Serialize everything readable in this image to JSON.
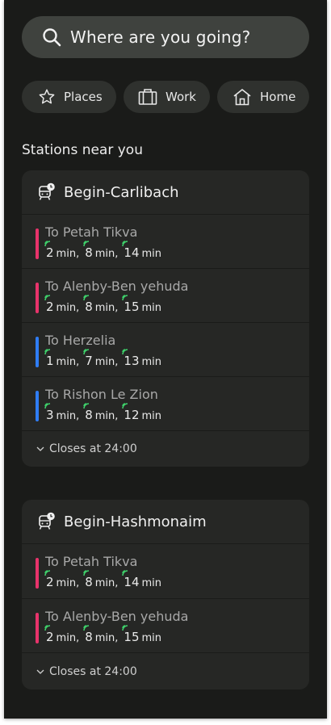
{
  "search": {
    "placeholder": "Where are you going?"
  },
  "quick_links": [
    {
      "label": "Places",
      "icon": "star-icon"
    },
    {
      "label": "Work",
      "icon": "briefcase-icon"
    },
    {
      "label": "Home",
      "icon": "home-icon"
    }
  ],
  "section_title": "Stations near you",
  "colors": {
    "pink": "#e8336b",
    "blue": "#2f7df5",
    "signal": "#3ecf6a"
  },
  "stations": [
    {
      "name": "Begin-Carlibach",
      "icon": "train-clock-icon",
      "routes": [
        {
          "dest": "To Petah Tikva",
          "color": "#e8336b",
          "times": [
            "2",
            "8",
            "14"
          ],
          "unit": "min"
        },
        {
          "dest": "To Alenby-Ben yehuda",
          "color": "#e8336b",
          "times": [
            "2",
            "8",
            "15"
          ],
          "unit": "min"
        },
        {
          "dest": "To Herzelia",
          "color": "#2f7df5",
          "times": [
            "1",
            "7",
            "13"
          ],
          "unit": "min"
        },
        {
          "dest": "To Rishon Le Zion",
          "color": "#2f7df5",
          "times": [
            "3",
            "8",
            "12"
          ],
          "unit": "min"
        }
      ],
      "closes": "Closes at 24:00"
    },
    {
      "name": "Begin-Hashmonaim",
      "icon": "train-clock-icon",
      "routes": [
        {
          "dest": "To Petah Tikva",
          "color": "#e8336b",
          "times": [
            "2",
            "8",
            "14"
          ],
          "unit": "min"
        },
        {
          "dest": "To Alenby-Ben yehuda",
          "color": "#e8336b",
          "times": [
            "2",
            "8",
            "15"
          ],
          "unit": "min"
        }
      ],
      "closes": "Closes at 24:00"
    }
  ]
}
